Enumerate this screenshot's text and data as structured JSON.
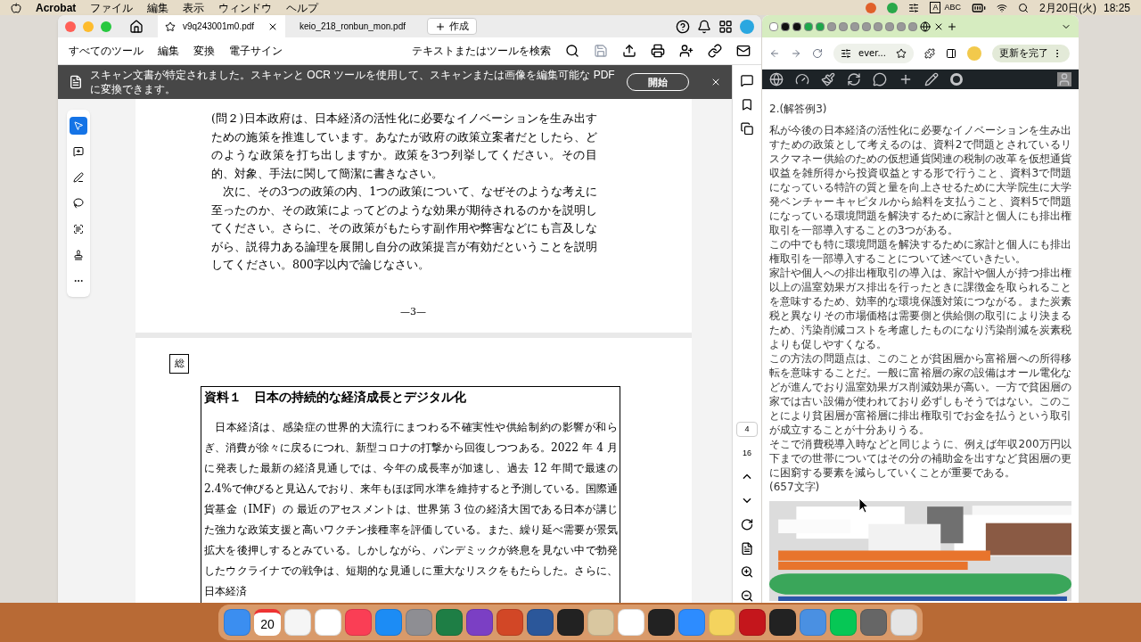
{
  "menubar": {
    "app": "Acrobat",
    "menus": [
      "ファイル",
      "編集",
      "表示",
      "ウィンドウ",
      "ヘルプ"
    ],
    "input_mode": "A",
    "input_label": "ABC",
    "date": "2月20日(火)",
    "time": "18:25"
  },
  "acrobat": {
    "tabs": [
      {
        "label": "v9q243001m0.pdf",
        "selected": true
      },
      {
        "label": "keio_218_ronbun_mon.pdf",
        "selected": false
      }
    ],
    "new_tab": "作成",
    "toolbar": [
      "すべてのツール",
      "編集",
      "変換",
      "電子サイン"
    ],
    "search": "テキストまたはツールを検索",
    "banner": {
      "message": "スキャン文書が特定されました。スキャンと OCR ツールを使用して、スキャンまたは画像を編集可能な PDF に変換できます。",
      "button": "開始"
    },
    "tools": [
      {
        "kind": "select",
        "selected": true
      },
      {
        "kind": "comment",
        "selected": false
      },
      {
        "kind": "draw",
        "selected": false
      },
      {
        "kind": "lasso",
        "selected": false
      },
      {
        "kind": "text",
        "selected": false
      },
      {
        "kind": "stamp",
        "selected": false
      },
      {
        "kind": "more",
        "selected": false
      }
    ],
    "page1": {
      "paragraphs": [
        "(問２)日本政府は、日本経済の活性化に必要なイノベーションを生み出すための施策を推進しています。あなたが政府の政策立案者だとしたら、どのような政策を打ち出しますか。政策を3つ列挙してください。その目的、対象、手法に関して簡潔に書きなさい。",
        "次に、その3つの政策の内、1つの政策について、なぜそのような考えに至ったのか、その政策によってどのような効果が期待されるのかを説明してください。さらに、その政策がもたらす副作用や弊害などにも言及しながら、説得力ある論理を展開し自分の政策提言が有効だということを説明してください。800字以内で論じなさい。"
      ],
      "page_number": "—3—"
    },
    "page2": {
      "stamp": "総",
      "title": "資料１　日本の持続的な経済成長とデジタル化",
      "paragraph": "日本経済は、感染症の世界的大流行にまつわる不確実性や供給制約の影響が和らぎ、消費が徐々に戻るにつれ、新型コロナの打撃から回復しつつある。2022 年 4 月に発表した最新の経済見通しでは、今年の成長率が加速し、過去 12 年間で最速の 2.4%で伸びると見込んでおり、来年もほぼ同水準を維持すると予測している。国際通貨基金（IMF）の 最近のアセスメントは、世界第 3 位の経済大国である日本が講じた強力な政策支援と高いワクチン接種率を評価している。また、繰り延べ需要が景気拡大を後押しするとみている。しかしながら、パンデミックが終息を見ない中で勃発したウクライナでの戦争は、短期的な見通しに重大なリスクをもたらした。さらに、日本経済"
    },
    "page_indicator": {
      "current": "4",
      "total": "16"
    }
  },
  "browser": {
    "address": "ever...",
    "update_button": "更新を完了",
    "heading": "2.(解答例3)",
    "paragraphs": [
      "私が今後の日本経済の活性化に必要なイノベーションを生み出すための政策として考えるのは、資料2で問題とされているリスクマネー供給のための仮想通貨関連の税制の改革を仮想通貨収益を雑所得から投資収益とする形で行うこと、資料3で問題になっている特許の質と量を向上させるために大学院生に大学発ベンチャーキャピタルから給料を支払うこと、資料5で問題になっている環境問題を解決するために家計と個人にも排出権取引を一部導入することの3つがある。",
      "この中でも特に環境問題を解決するために家計と個人にも排出権取引を一部導入することについて述べていきたい。",
      "家計や個人への排出権取引の導入は、家計や個人が持つ排出権以上の温室効果ガス排出を行ったときに課徴金を取られることを意味するため、効率的な環境保護対策につながる。また炭素税と異なりその市場価格は需要側と供給側の取引により決まるため、汚染削減コストを考慮したものになり汚染削減を炭素税よりも促しやすくなる。",
      "この方法の問題点は、このことが貧困層から富裕層への所得移転を意味することだ。一般に富裕層の家の設備はオール電化などが進んでおり温室効果ガス削減効果が高い。一方で貧困層の家では古い設備が使われており必ずしもそうではない。このことにより貧困層が富裕層に排出権取引でお金を払うという取引が成立することが十分ありうる。",
      "そこで消費税導入時などと同じように、例えば年収200万円以下までの世帯についてはその分の補助金を出すなど貧困層の更に困窮する要素を減らしていくことが重要である。"
    ],
    "count": "(657文字)"
  },
  "dock": {
    "calendar_day": "20"
  }
}
